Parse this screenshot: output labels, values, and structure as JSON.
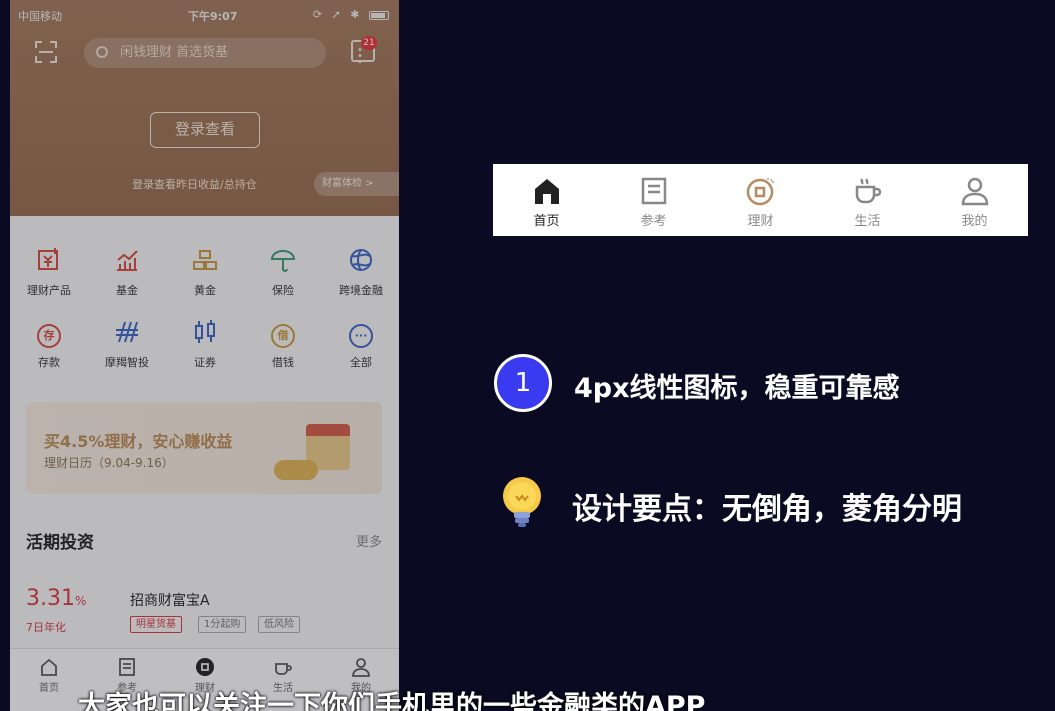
{
  "phone": {
    "status": {
      "carrier": "中国移动",
      "time": "下午9:07"
    },
    "search_placeholder": "闲钱理财 首选货基",
    "message_count": "21",
    "login_button": "登录查看",
    "login_hint": "登录查看昨日收益/总持仓",
    "wealth_check": "财富体检 >",
    "grid": [
      {
        "label": "理财产品",
        "icon": "wealth-product-icon"
      },
      {
        "label": "基金",
        "icon": "fund-icon"
      },
      {
        "label": "黄金",
        "icon": "gold-icon"
      },
      {
        "label": "保险",
        "icon": "umbrella-icon"
      },
      {
        "label": "跨境金融",
        "icon": "globe-icon"
      },
      {
        "label": "存款",
        "icon": "deposit-icon",
        "glyph": "存"
      },
      {
        "label": "摩羯智投",
        "icon": "robo-advisor-icon"
      },
      {
        "label": "证券",
        "icon": "candlestick-icon"
      },
      {
        "label": "借钱",
        "icon": "borrow-icon",
        "glyph": "借"
      },
      {
        "label": "全部",
        "icon": "more-dots-icon",
        "glyph": "···"
      }
    ],
    "banner": {
      "headline": "买4.5%理财，安心赚收益",
      "subline": "理财日历（9.04-9.16）"
    },
    "section": {
      "title": "活期投资",
      "more": "更多"
    },
    "product": {
      "rate": "3.31",
      "rate_unit": "%",
      "rate_label": "7日年化",
      "name": "招商财富宝A",
      "tags": [
        "明星货基",
        "1分起购",
        "低风险"
      ]
    },
    "tabs": [
      {
        "label": "首页"
      },
      {
        "label": "参考"
      },
      {
        "label": "理财"
      },
      {
        "label": "生活"
      },
      {
        "label": "我的"
      }
    ]
  },
  "demo_tabbar": {
    "tabs": [
      {
        "label": "首页",
        "icon": "home-icon",
        "active": true
      },
      {
        "label": "参考",
        "icon": "document-icon",
        "active": false
      },
      {
        "label": "理财",
        "icon": "coin-icon",
        "active": false
      },
      {
        "label": "生活",
        "icon": "cup-icon",
        "active": false
      },
      {
        "label": "我的",
        "icon": "person-icon",
        "active": false
      }
    ]
  },
  "points": {
    "number": "1",
    "point1": "4px线性图标，稳重可靠感",
    "point2": "设计要点：无倒角，菱角分明"
  },
  "subtitle": "大家也可以关注一下你们手机里的一些金融类的APP",
  "colors": {
    "background": "#0b0a23",
    "hero": "#a3785a",
    "accent_number": "#3a3af0",
    "rate_red": "#d7393c"
  }
}
